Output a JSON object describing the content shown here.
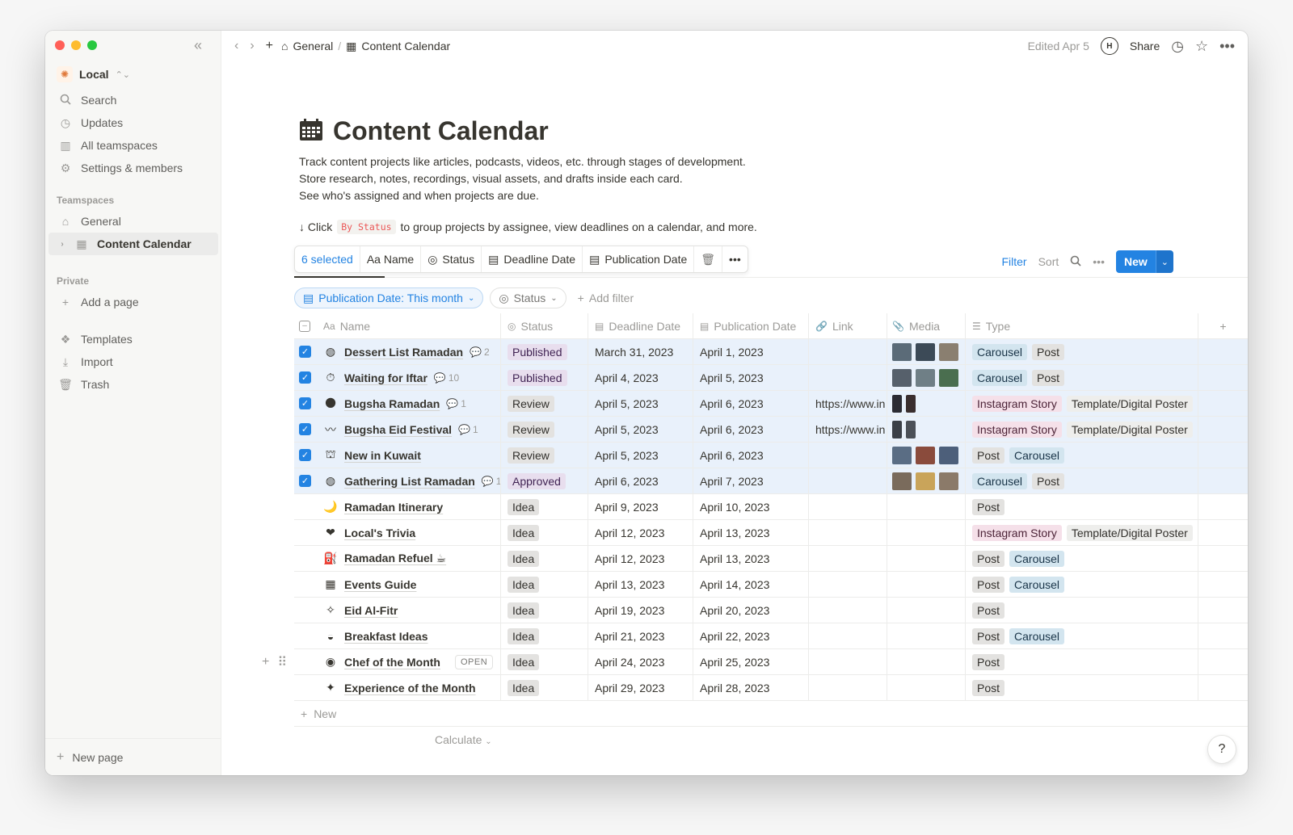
{
  "sidebar": {
    "workspace": "Local",
    "nav": [
      {
        "label": "Search",
        "icon": "search-icon"
      },
      {
        "label": "Updates",
        "icon": "clock-icon"
      },
      {
        "label": "All teamspaces",
        "icon": "grid-icon"
      },
      {
        "label": "Settings & members",
        "icon": "gear-icon"
      }
    ],
    "teamspaces_label": "Teamspaces",
    "teamspaces": [
      {
        "label": "General",
        "icon": "home-icon"
      },
      {
        "label": "Content Calendar",
        "icon": "calendar-icon"
      }
    ],
    "private_label": "Private",
    "add_page": "Add a page",
    "tools": [
      {
        "label": "Templates",
        "icon": "templates-icon"
      },
      {
        "label": "Import",
        "icon": "import-icon"
      },
      {
        "label": "Trash",
        "icon": "trash-icon"
      }
    ],
    "new_page": "New page"
  },
  "topbar": {
    "crumbs": [
      "General",
      "Content Calendar"
    ],
    "edited": "Edited Apr 5",
    "avatar": "H",
    "share": "Share"
  },
  "page": {
    "title": "Content Calendar",
    "description": [
      "Track content projects like articles, podcasts, videos, etc. through stages of development.",
      "Store research, notes, recordings, visual assets, and drafts inside each card.",
      "See who's assigned and when projects are due."
    ],
    "hint_prefix": "↓ Click",
    "hint_code": "By Status",
    "hint_suffix": "to group projects by assignee, view deadlines on a calendar, and more."
  },
  "selection_bar": {
    "selected": "6 selected",
    "name": "Aa Name",
    "status": "Status",
    "deadline": "Deadline Date",
    "publication": "Publication Date"
  },
  "view_actions": {
    "filter": "Filter",
    "sort": "Sort",
    "new": "New"
  },
  "filters": {
    "pub": "Publication Date: This month",
    "status": "Status",
    "add": "Add filter"
  },
  "columns": {
    "name": "Name",
    "name_prefix": "Aa",
    "status": "Status",
    "deadline": "Deadline Date",
    "publication": "Publication Date",
    "link": "Link",
    "media": "Media",
    "type": "Type"
  },
  "rows": [
    {
      "icon": "◍",
      "name": "Dessert List Ramadan",
      "comments": "2",
      "status": "Published",
      "deadline": "March 31, 2023",
      "pub": "April 1, 2023",
      "link": "",
      "selected": true
    },
    {
      "icon": "⏱",
      "name": "Waiting for Iftar",
      "comments": "10",
      "status": "Published",
      "deadline": "April 4, 2023",
      "pub": "April 5, 2023",
      "link": "",
      "selected": true
    },
    {
      "icon": "🌑",
      "name": "Bugsha Ramadan",
      "comments": "1",
      "status": "Review",
      "deadline": "April 5, 2023",
      "pub": "April 6, 2023",
      "link": "https://www.in",
      "selected": true
    },
    {
      "icon": "〰",
      "name": "Bugsha Eid Festival",
      "comments": "1",
      "status": "Review",
      "deadline": "April 5, 2023",
      "pub": "April 6, 2023",
      "link": "https://www.in",
      "selected": true
    },
    {
      "icon": "⛫",
      "name": "New in Kuwait",
      "comments": "",
      "status": "Review",
      "deadline": "April 5, 2023",
      "pub": "April 6, 2023",
      "link": "",
      "selected": true
    },
    {
      "icon": "◍",
      "name": "Gathering List Ramadan",
      "comments": "1",
      "status": "Approved",
      "deadline": "April 6, 2023",
      "pub": "April 7, 2023",
      "link": "",
      "selected": true
    },
    {
      "icon": "🌙",
      "name": "Ramadan Itinerary",
      "comments": "",
      "status": "Idea",
      "deadline": "April 9, 2023",
      "pub": "April 10, 2023",
      "link": "",
      "selected": false
    },
    {
      "icon": "❤",
      "name": "Local's Trivia",
      "comments": "",
      "status": "Idea",
      "deadline": "April 12, 2023",
      "pub": "April 13, 2023",
      "link": "",
      "selected": false
    },
    {
      "icon": "⛽",
      "name": "Ramadan Refuel ☕",
      "comments": "",
      "status": "Idea",
      "deadline": "April 12, 2023",
      "pub": "April 13, 2023",
      "link": "",
      "selected": false
    },
    {
      "icon": "▦",
      "name": "Events Guide",
      "comments": "",
      "status": "Idea",
      "deadline": "April 13, 2023",
      "pub": "April 14, 2023",
      "link": "",
      "selected": false
    },
    {
      "icon": "✧",
      "name": "Eid Al-Fitr",
      "comments": "",
      "status": "Idea",
      "deadline": "April 19, 2023",
      "pub": "April 20, 2023",
      "link": "",
      "selected": false
    },
    {
      "icon": "◒",
      "name": "Breakfast Ideas",
      "comments": "",
      "status": "Idea",
      "deadline": "April 21, 2023",
      "pub": "April 22, 2023",
      "link": "",
      "selected": false
    },
    {
      "icon": "◉",
      "name": "Chef of the Month",
      "comments": "",
      "status": "Idea",
      "deadline": "April 24, 2023",
      "pub": "April 25, 2023",
      "link": "",
      "selected": false,
      "open": "OPEN"
    },
    {
      "icon": "✦",
      "name": "Experience of the Month",
      "comments": "",
      "status": "Idea",
      "deadline": "April 29, 2023",
      "pub": "April 28, 2023",
      "link": "",
      "selected": false
    }
  ],
  "row_types": [
    [
      "Carousel",
      "Post"
    ],
    [
      "Carousel",
      "Post"
    ],
    [
      "Instagram Story",
      "Template/Digital Poster"
    ],
    [
      "Instagram Story",
      "Template/Digital Poster"
    ],
    [
      "Post",
      "Carousel"
    ],
    [
      "Carousel",
      "Post"
    ],
    [
      "Post"
    ],
    [
      "Instagram Story",
      "Template/Digital Poster"
    ],
    [
      "Post",
      "Carousel"
    ],
    [
      "Post",
      "Carousel"
    ],
    [
      "Post"
    ],
    [
      "Post",
      "Carousel"
    ],
    [
      "Post"
    ],
    [
      "Post"
    ]
  ],
  "table_footer": {
    "new": "New",
    "calculate": "Calculate"
  },
  "help": "?",
  "colors": {
    "accent": "#2383e2",
    "selected_row": "#e9f1fb"
  }
}
